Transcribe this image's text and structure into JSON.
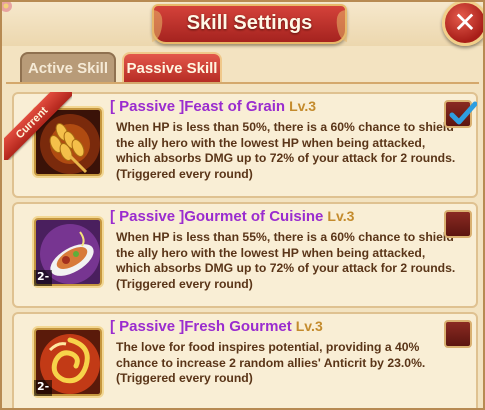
{
  "window": {
    "title": "Skill Settings",
    "close_icon": "close-icon"
  },
  "tabs": [
    {
      "label": "Active Skill",
      "selected": false
    },
    {
      "label": "Passive Skill",
      "selected": true
    }
  ],
  "skills": [
    {
      "type": "[ Passive ]",
      "name": "Feast of Grain",
      "level": "Lv.3",
      "description": "When HP is less than 50%, there is a 60% chance to shield the ally hero with the lowest HP when being attacked, which absorbs DMG up to 72% of your attack for 2 rounds. (Triggered every round)",
      "current_badge": "Current",
      "checked": true,
      "icon": "grain-icon"
    },
    {
      "type": "[ Passive ]",
      "name": "Gourmet of Cuisine",
      "level": "Lv.3",
      "description": "When HP is less than 55%, there is a 60% chance to shield the ally hero with the lowest HP when being attacked, which absorbs DMG up to 72% of your attack for 2 rounds. (Triggered every round)",
      "level_badge": "2-",
      "checked": false,
      "icon": "cuisine-icon"
    },
    {
      "type": "[ Passive ]",
      "name": "Fresh Gourmet",
      "level": "Lv.3",
      "description": "The love for food inspires potential, providing a 40% chance to increase 2 random allies' Anticrit by 23.0%. (Triggered every round)",
      "level_badge": "2-",
      "checked": false,
      "icon": "fire-swirl-icon"
    }
  ],
  "colors": {
    "accent_red": "#c0302a",
    "passive_purple": "#9a2ccf",
    "level_gold": "#c48b2d",
    "text_brown": "#5a3518"
  }
}
